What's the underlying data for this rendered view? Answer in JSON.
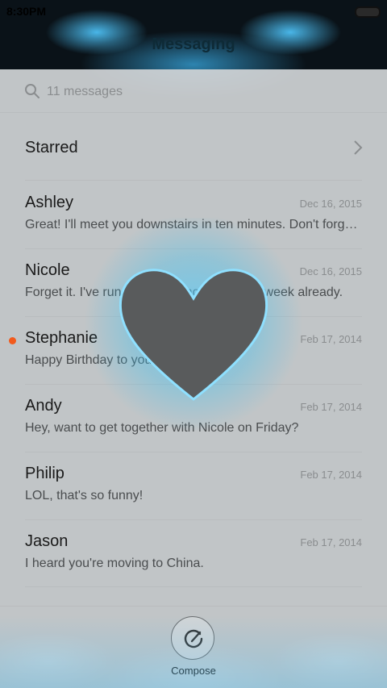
{
  "status_bar": {
    "time": "8:30PM"
  },
  "header": {
    "title": "Messaging"
  },
  "search": {
    "count_text": "11 messages"
  },
  "starred": {
    "label": "Starred"
  },
  "conversations": [
    {
      "name": "Ashley",
      "date": "Dec 16, 2015",
      "preview": "Great! I'll meet you downstairs in ten minutes. Don't forge…",
      "unread": false
    },
    {
      "name": "Nicole",
      "date": "Dec 16, 2015",
      "preview": "Forget it. I've run out of my money for the week already.",
      "unread": false
    },
    {
      "name": "Stephanie",
      "date": "Feb 17, 2014",
      "preview": "Happy Birthday to you!",
      "unread": true
    },
    {
      "name": "Andy",
      "date": "Feb 17, 2014",
      "preview": "Hey, want to get together with Nicole on Friday?",
      "unread": false
    },
    {
      "name": "Philip",
      "date": "Feb 17, 2014",
      "preview": "LOL, that's so funny!",
      "unread": false
    },
    {
      "name": "Jason",
      "date": "Feb 17, 2014",
      "preview": "I heard you're moving to China.",
      "unread": false
    }
  ],
  "compose": {
    "label": "Compose"
  },
  "colors": {
    "unread_dot": "#f25a1c",
    "wallpaper_accent": "#3cc0f0"
  },
  "icons": {
    "search": "search-icon",
    "chevron": "chevron-right-icon",
    "compose": "compose-icon",
    "battery": "battery-icon"
  }
}
